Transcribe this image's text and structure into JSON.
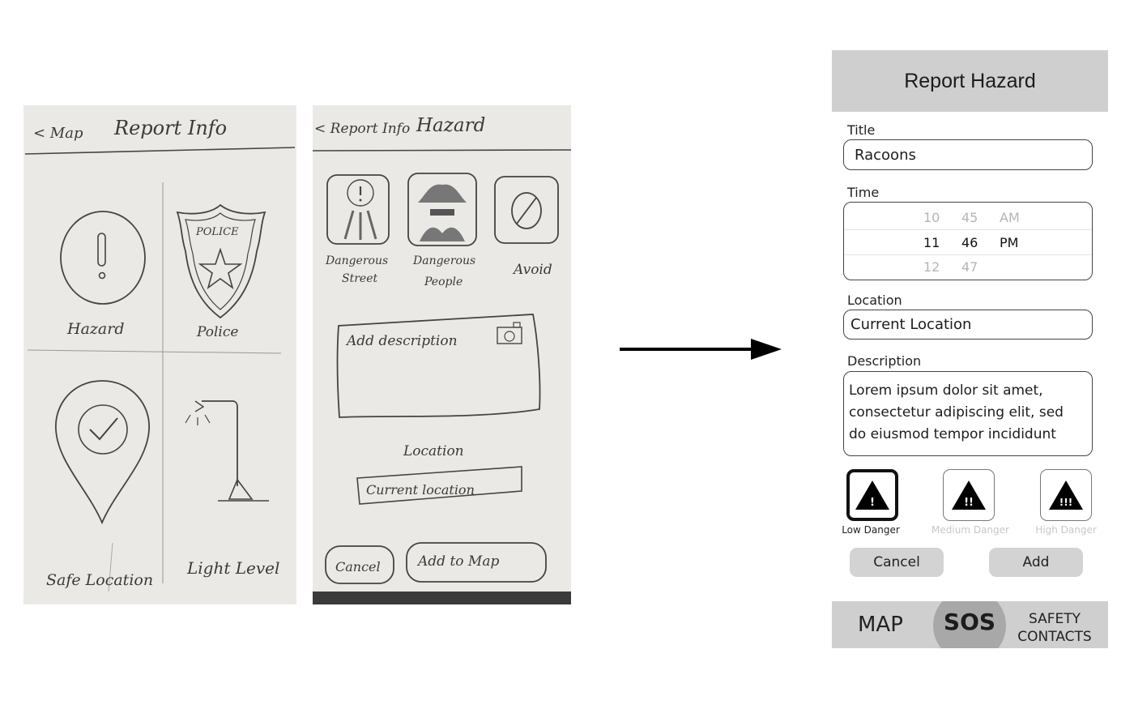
{
  "sketch_report_info": {
    "back_label": "< Map",
    "title": "Report Info",
    "items": [
      "Hazard",
      "Police",
      "Safe Location",
      "Light Level"
    ],
    "badge_text": "POLICE"
  },
  "sketch_hazard": {
    "back_label": "< Report Info",
    "title": "Hazard",
    "categories": [
      {
        "line1": "Dangerous",
        "line2": "Street"
      },
      {
        "line1": "Dangerous",
        "line2": "People"
      },
      {
        "line1": "Avoid",
        "line2": ""
      }
    ],
    "description_placeholder": "Add description",
    "location_label": "Location",
    "location_value": "Current location",
    "cancel_label": "Cancel",
    "add_label": "Add to Map"
  },
  "form": {
    "header": "Report Hazard",
    "title_label": "Title",
    "title_value": "Racoons",
    "time_label": "Time",
    "time_rows": [
      {
        "hour": "10",
        "minute": "45",
        "period": "AM"
      },
      {
        "hour": "11",
        "minute": "46",
        "period": "PM"
      },
      {
        "hour": "12",
        "minute": "47",
        "period": ""
      }
    ],
    "location_label": "Location",
    "location_value": "Current Location",
    "description_label": "Description",
    "description_lines": [
      "Lorem ipsum dolor sit amet,",
      "consectetur adipiscing elit, sed",
      "do eiusmod tempor incididunt"
    ],
    "danger_levels": [
      {
        "label": "Low Danger",
        "mark": "!",
        "selected": true
      },
      {
        "label": "Medium Danger",
        "mark": "!!",
        "selected": false
      },
      {
        "label": "High Danger",
        "mark": "!!!",
        "selected": false
      }
    ],
    "cancel_label": "Cancel",
    "add_label": "Add"
  },
  "tabbar": {
    "map_label": "MAP",
    "sos_label": "SOS",
    "safety_line1": "SAFETY",
    "safety_line2": "CONTACTS"
  }
}
